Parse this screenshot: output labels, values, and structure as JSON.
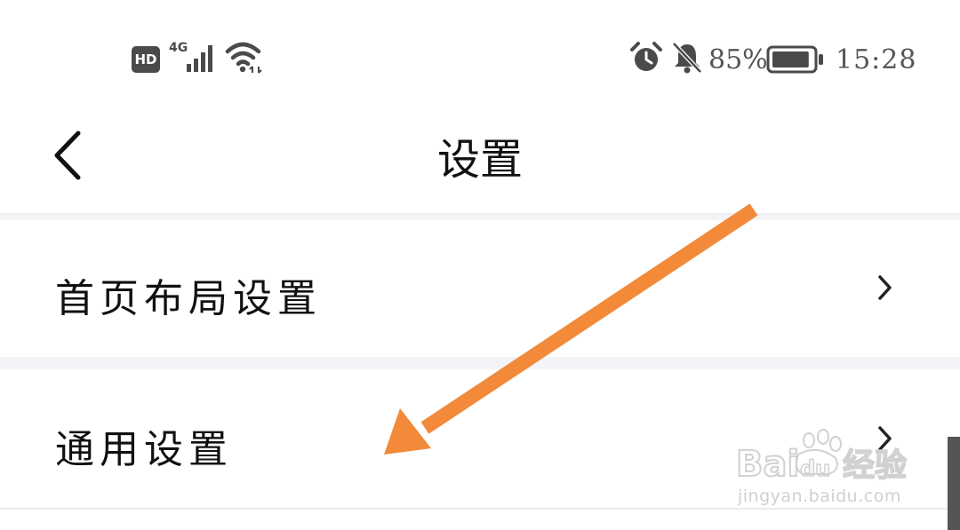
{
  "status_bar": {
    "hd_label": "HD",
    "network_type": "4G",
    "signal_icon": "cellular-signal-icon",
    "wifi_icon": "wifi-icon",
    "alarm_icon": "alarm-clock-icon",
    "mute_icon": "bell-muted-icon",
    "battery_percent": "85%",
    "battery_level": 0.85,
    "time": "15:28"
  },
  "header": {
    "back_icon": "back-chevron-icon",
    "title": "设置"
  },
  "settings": {
    "items": [
      {
        "label": "首页布局设置",
        "icon": "chevron-right-icon"
      },
      {
        "label": "通用设置",
        "icon": "chevron-right-icon"
      }
    ]
  },
  "annotation": {
    "arrow_color": "#f28a3a"
  },
  "watermark": {
    "logo_text": "Baidu经验",
    "url": "jingyan.baidu.com"
  },
  "colors": {
    "background": "#ffffff",
    "section_gap": "#f4f4f8",
    "text": "#111111",
    "status_text": "#555555"
  }
}
